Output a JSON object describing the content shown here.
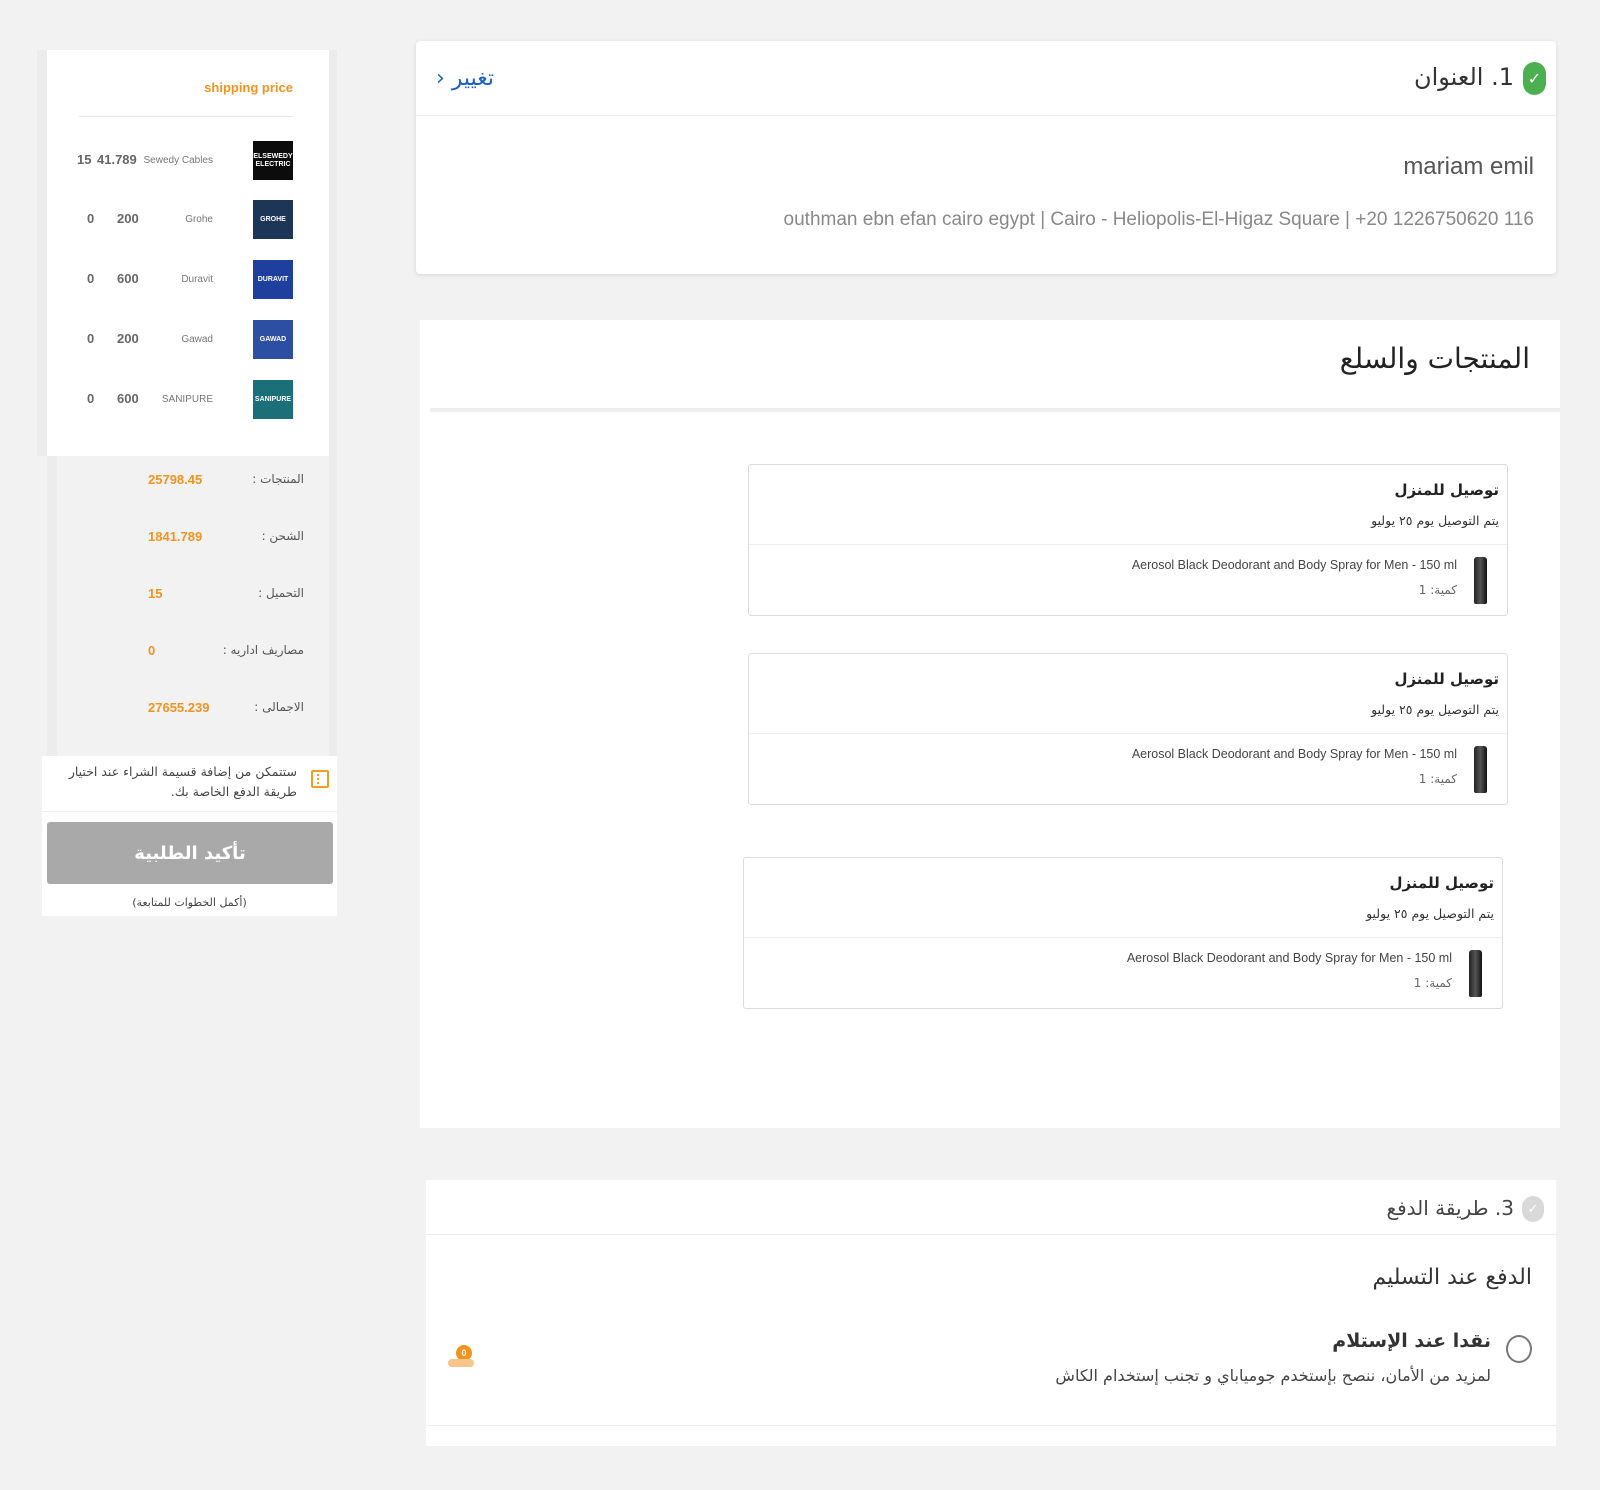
{
  "summary": {
    "shipping_title": "shipping price",
    "brands": [
      {
        "logo": "ELSEWEDY ELECTRIC",
        "name": "Sewedy Cables",
        "price": "41.789",
        "fee": "15",
        "color": "#0c0c0c"
      },
      {
        "logo": "GROHE",
        "name": "Grohe",
        "price": "200",
        "fee": "0",
        "color": "#1d3557"
      },
      {
        "logo": "DURAVIT",
        "name": "Duravit",
        "price": "600",
        "fee": "0",
        "color": "#1f3f9e"
      },
      {
        "logo": "GAWAD",
        "name": "Gawad",
        "price": "200",
        "fee": "0",
        "color": "#2d4fa3"
      },
      {
        "logo": "SANIPURE",
        "name": "SANIPURE",
        "price": "600",
        "fee": "0",
        "color": "#1a6f78"
      }
    ],
    "totals": [
      {
        "label": "المنتجات :",
        "value": "25798.45"
      },
      {
        "label": "الشحن :",
        "value": "1841.789"
      },
      {
        "label": "التحميل :",
        "value": "15"
      },
      {
        "label": "مصاريف اداريه :",
        "value": "0"
      },
      {
        "label": "الاجمالى :",
        "value": "27655.239"
      }
    ],
    "installment_note": "ستتمكن من إضافة قسيمة الشراء عند اختيار طريقة الدفع الخاصة بك.",
    "confirm_label": "تأكيد الطلبية",
    "confirm_hint": "(أكمل الخطوات للمتابعة)"
  },
  "address": {
    "step_title": "1. العنوان",
    "change_label": "تغيير ‹",
    "name": "mariam emil",
    "line": "outhman ebn efan cairo egypt | Cairo - Heliopolis-El-Higaz Square | +20 1226750620 116"
  },
  "products": {
    "title": "المنتجات والسلع",
    "shipments": [
      {
        "title": "توصيل للمنزل",
        "date": "يتم التوصيل يوم ٢٥ يوليو",
        "item": "Aerosol Black Deodorant and Body Spray for Men - 150 ml",
        "qty": "كمية: 1"
      },
      {
        "title": "توصيل للمنزل",
        "date": "يتم التوصيل يوم ٢٥ يوليو",
        "item": "Aerosol Black Deodorant and Body Spray for Men - 150 ml",
        "qty": "كمية: 1"
      },
      {
        "title": "توصيل للمنزل",
        "date": "يتم التوصيل يوم ٢٥ يوليو",
        "item": "Aerosol Black Deodorant and Body Spray for Men - 150 ml",
        "qty": "كمية: 1"
      }
    ]
  },
  "payment": {
    "step_title": "3. طريقة الدفع",
    "section_title": "الدفع عند التسليم",
    "option_label": "نقدا عند الإستلام",
    "option_desc": "لمزيد من الأمان، ننصح بإستخدم جومياباي و تجنب إستخدام الكاش",
    "coin_badge": "0"
  },
  "colors": {
    "accent": "#f0931f",
    "link": "#1b64c4",
    "success": "#4caf50",
    "disabled_button": "#a9a9a9"
  }
}
